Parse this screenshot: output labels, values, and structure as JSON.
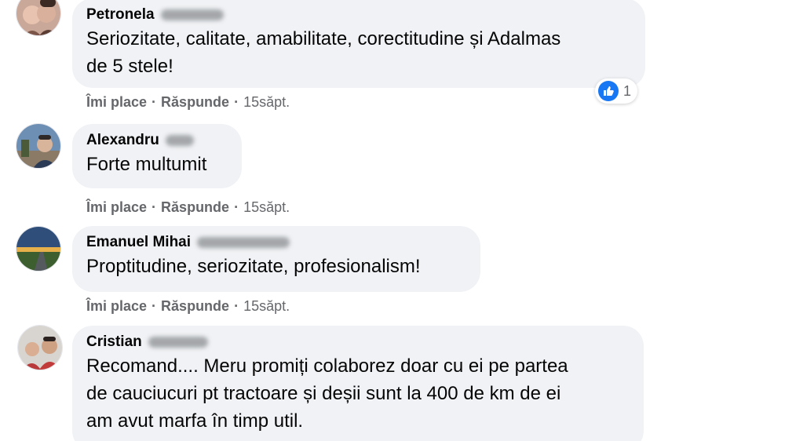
{
  "colors": {
    "bubble": "#f0f2f5",
    "action_text": "#65676b",
    "like_blue": "#1877f2"
  },
  "actions": {
    "like": "Îmi place",
    "reply": "Răspunde",
    "separator": "·"
  },
  "comments": [
    {
      "author": "Petronela",
      "lines": [
        "Seriozitate, calitate, amabilitate, corectitudine și Adalmas",
        "de 5 stele!"
      ],
      "time": "15săpt.",
      "reaction": {
        "icon": "like-icon",
        "count": "1"
      }
    },
    {
      "author": "Alexandru",
      "lines": [
        "Forte multumit"
      ],
      "time": "15săpt."
    },
    {
      "author": "Emanuel Mihai",
      "lines": [
        "Proptitudine, seriozitate, profesionalism!"
      ],
      "time": "15săpt."
    },
    {
      "author": "Cristian",
      "lines": [
        "Recomand.... Meru promiți colaborez doar cu ei pe partea",
        "de cauciucuri pt tractoare și deșii sunt la 400 de km de ei",
        "am avut marfa în timp util."
      ]
    }
  ]
}
